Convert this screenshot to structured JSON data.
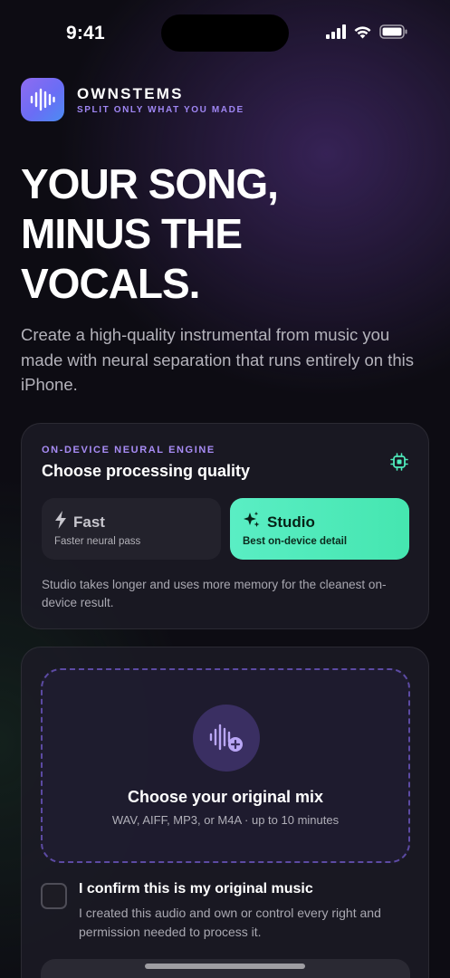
{
  "status_bar": {
    "time": "9:41",
    "icons": [
      "cellular-signal-icon",
      "wifi-icon",
      "battery-icon"
    ]
  },
  "brand": {
    "logo_icon": "waveform-icon",
    "name": "OWNSTEMS",
    "tagline": "SPLIT ONLY WHAT YOU MADE"
  },
  "hero": {
    "title_lines": [
      "YOUR SONG,",
      "MINUS THE",
      "VOCALS."
    ],
    "description": "Create a high-quality instrumental from music you made with neural separation that runs entirely on this iPhone."
  },
  "quality": {
    "eyebrow": "ON-DEVICE NEURAL ENGINE",
    "title": "Choose processing quality",
    "chip_icon": "chip-icon",
    "options": [
      {
        "label": "Fast",
        "subtitle": "Faster neural pass",
        "icon": "bolt-icon",
        "selected": false
      },
      {
        "label": "Studio",
        "subtitle": "Best on-device detail",
        "icon": "sparkles-icon",
        "selected": true
      }
    ],
    "note": "Studio takes longer and uses more memory for the cleanest on-device result."
  },
  "upload": {
    "icon": "waveform-add-icon",
    "title": "Choose your original mix",
    "subtitle": "WAV, AIFF, MP3, or M4A · up to 10 minutes",
    "confirm_title": "I confirm this is my original music",
    "confirm_desc": "I created this audio and own or control every right and permission needed to process it.",
    "confirm_checked": false
  },
  "colors": {
    "accent_purple": "#9f86f3",
    "accent_green": "#4fecbc",
    "background": "#0d0c13"
  }
}
